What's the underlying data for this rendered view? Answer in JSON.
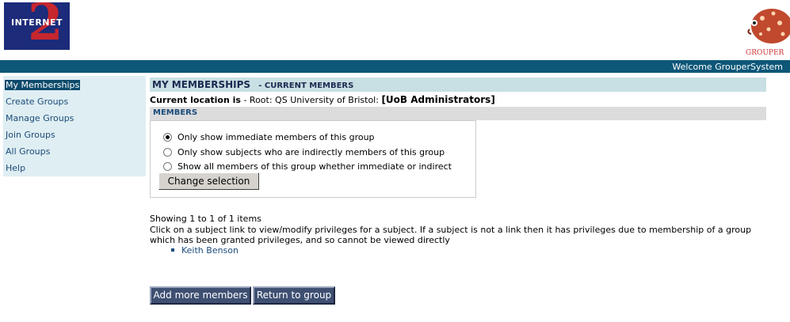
{
  "logo": {
    "text": "INTERNET",
    "numeral": "2"
  },
  "brand": {
    "mascot_label": "GROUPER"
  },
  "header": {
    "welcome": "Welcome GrouperSystem"
  },
  "colors": {
    "header_bar": "#0d5778",
    "sidebar_bg": "#dfeef2",
    "heading_bg": "#c8dfe3",
    "button_bg": "#3e4f72"
  },
  "sidebar": {
    "items": [
      {
        "label": "My Memberships",
        "active": true
      },
      {
        "label": "Create Groups"
      },
      {
        "label": "Manage Groups"
      },
      {
        "label": "Join Groups"
      },
      {
        "label": "All Groups"
      },
      {
        "label": "Help"
      }
    ]
  },
  "page": {
    "title": "MY MEMBERSHIPS",
    "subtitle": "- CURRENT MEMBERS",
    "location_label": "Current location is",
    "location_path": " - Root: QS University of Bristol: ",
    "location_group": "[UoB Administrators]"
  },
  "members": {
    "heading": "MEMBERS",
    "options": [
      {
        "label": "Only show immediate members of this group",
        "checked": true
      },
      {
        "label": "Only show subjects who are indirectly members of this group",
        "checked": false
      },
      {
        "label": "Show all members of this group whether immediate or indirect",
        "checked": false
      }
    ],
    "change_button": "Change selection"
  },
  "results": {
    "showing": "Showing 1 to 1 of 1 items",
    "info": "Click on a subject link to view/modify privileges for a subject. If a subject is not a link then it has privileges due to membership of a group which has been granted privileges, and so cannot be viewed directly",
    "subjects": [
      "Keith Benson"
    ]
  },
  "actions": {
    "add_members": "Add more members",
    "return_group": "Return to group"
  }
}
